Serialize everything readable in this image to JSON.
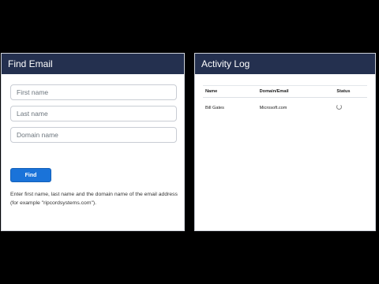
{
  "find_email": {
    "title": "Find Email",
    "first_name_placeholder": "First name",
    "last_name_placeholder": "Last name",
    "domain_placeholder": "Domain name",
    "find_label": "Find",
    "help_text": "Enter first name, last name and the domain name of the email address (for example \"ripcordsystems.com\")."
  },
  "activity_log": {
    "title": "Activity Log",
    "columns": [
      "Name",
      "Domain/Email",
      "Status"
    ],
    "rows": [
      {
        "name": "Bill Gates",
        "domain": "Microsoft.com",
        "status_icon": "loading-spinner-icon"
      }
    ]
  }
}
